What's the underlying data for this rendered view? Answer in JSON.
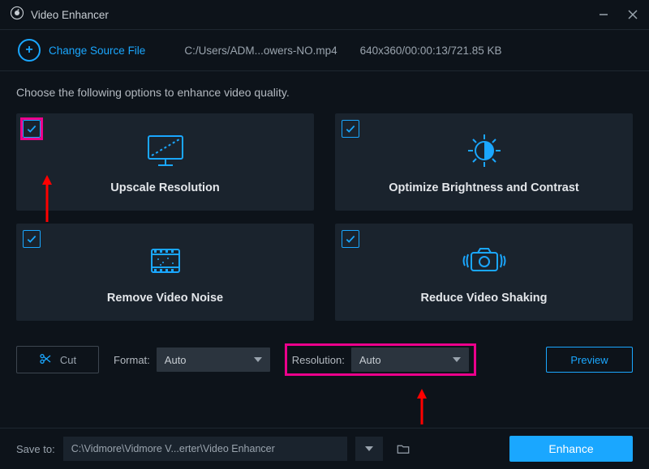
{
  "window": {
    "title": "Video Enhancer"
  },
  "source": {
    "change_label": "Change Source File",
    "filepath": "C:/Users/ADM...owers-NO.mp4",
    "meta": "640x360/00:00:13/721.85 KB"
  },
  "instruction": "Choose the following options to enhance video quality.",
  "cards": {
    "upscale": "Upscale Resolution",
    "brightness": "Optimize Brightness and Contrast",
    "noise": "Remove Video Noise",
    "shaking": "Reduce Video Shaking"
  },
  "controls": {
    "cut": "Cut",
    "format_label": "Format:",
    "format_value": "Auto",
    "resolution_label": "Resolution:",
    "resolution_value": "Auto",
    "preview": "Preview"
  },
  "footer": {
    "save_to_label": "Save to:",
    "save_path": "C:\\Vidmore\\Vidmore V...erter\\Video Enhancer",
    "enhance": "Enhance"
  }
}
